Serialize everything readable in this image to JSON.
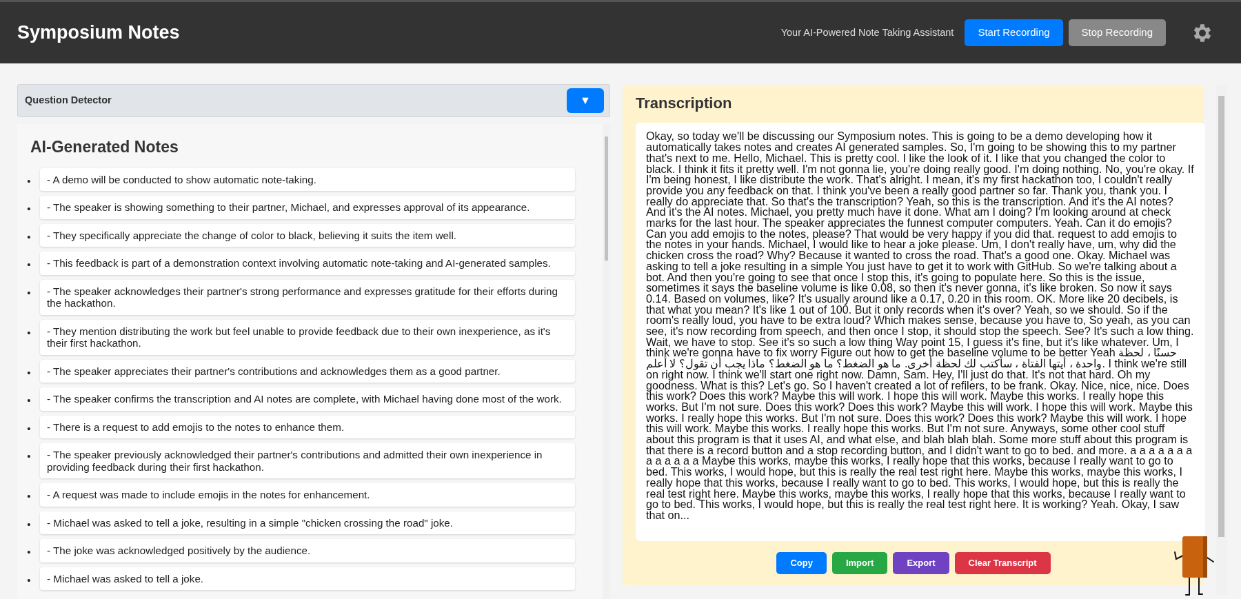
{
  "header": {
    "title": "Symposium Notes",
    "tagline": "Your AI-Powered Note Taking Assistant",
    "start_button": {
      "label": "Start Recording",
      "kind": "primary"
    },
    "stop_button": {
      "label": "Stop Recording",
      "kind": "secondary"
    }
  },
  "question_detector": {
    "title": "Question Detector",
    "toggle": "▼"
  },
  "notes": {
    "title": "AI-Generated Notes",
    "items": [
      {
        "marker": "•",
        "text": "- A demo will be conducted to show automatic note-taking."
      },
      {
        "marker": "•",
        "text": "- The speaker is showing something to their partner, Michael, and expresses approval of its appearance."
      },
      {
        "marker": "•",
        "text": "- They specifically appreciate the change of color to black, believing it suits the item well."
      },
      {
        "marker": "•",
        "text": "- This feedback is part of a demonstration context involving automatic note-taking and AI-generated samples."
      },
      {
        "marker": "•",
        "text": "- The speaker acknowledges their partner's strong performance and expresses gratitude for their efforts during the hackathon."
      },
      {
        "marker": "•",
        "text": "- They mention distributing the work but feel unable to provide feedback due to their own inexperience, as it's their first hackathon."
      },
      {
        "marker": "•",
        "text": "- The speaker appreciates their partner's contributions and acknowledges them as a good partner."
      },
      {
        "marker": "•",
        "text": "- The speaker confirms the transcription and AI notes are complete, with Michael having done most of the work."
      },
      {
        "marker": "•",
        "text": "- There is a request to add emojis to the notes to enhance them."
      },
      {
        "marker": "•",
        "text": "- The speaker previously acknowledged their partner's contributions and admitted their own inexperience in providing feedback during their first hackathon."
      },
      {
        "marker": "•",
        "text": "- A request was made to include emojis in the notes for enhancement."
      },
      {
        "marker": "•",
        "text": "- Michael was asked to tell a joke, resulting in a simple \"chicken crossing the road\" joke."
      },
      {
        "marker": "•",
        "text": "- The joke was acknowledged positively by the audience."
      },
      {
        "marker": "•",
        "text": "- Michael was asked to tell a joke."
      }
    ]
  },
  "transcription": {
    "title": "Transcription",
    "text": "Okay, so today we'll be discussing our Symposium notes. This is going to be a demo developing how it automatically takes notes and creates AI generated samples. So, I'm going to be showing this to my partner that's next to me. Hello, Michael. This is pretty cool. I like the look of it. I like that you changed the color to black. I think it fits it pretty well. I'm not gonna lie, you're doing really good. I'm doing nothing. No, you're okay. If I'm being honest, I like distribute the work. That's alright. I mean, it's my first hackathon too, I couldn't really provide you any feedback on that. I think you've been a really good partner so far. Thank you, thank you. I really do appreciate that. So that's the transcription? Yeah, so this is the transcription. And it's the AI notes? And it's the AI notes. Michael, you pretty much have it done. What am I doing? I'm looking around at check marks for the last hour. The speaker appreciates the funnest computer computers. Yeah. Can it do emojis? Can you add emojis to the notes, please? That would be very happy if you did that. request to add emojis to the notes in your hands. Michael, I would like to hear a joke please. Um, I don't really have, um, why did the chicken cross the road? Why? Because it wanted to cross the road. That's a good one. Okay. Michael was asking to tell a joke resulting in a simple You just have to get it to work with GitHub. So we're talking about a bot. And then you're going to see that once I stop this, it's going to populate here. So this is the issue, sometimes it says the baseline volume is like 0.08, so then it's never gonna, it's like broken. So now it says 0.14. Based on volumes, like? It's usually around like a 0.17, 0.20 in this room. OK. More like 20 decibels, is that what you mean? It's like 1 out of 100. But it only records when it's over? Yeah, so we should. So if the room's really loud, you have to be extra loud? Which makes sense, because you have to, So yeah, as you can see, it's now recording from speech, and then once I stop, it should stop the speech. See? It's such a low thing. Wait, we have to stop. See it's so such a low thing Way point 15, I guess it's fine, but it's like whatever. Um, I think we're gonna have to fix worry Figure out how to get the baseline volume to be better Yeah حسنًا ، لحظة واحدة ، أيتها الفتاة ، سأكتب لك لحظة أخرى. ما هو الضغط؟ ما هو الضغط؟ ماذا يجب أن تقول؟ لا أعلم. I think we're still on right now. I think we'll start one right now. Damn, Sam. Hey, I'll just do that. It's not that hard. Oh my goodness. What is this? Let's go. So I haven't created a lot of refilers, to be frank. Okay. Nice, nice, nice. Does this work? Does this work? Maybe this will work. I hope this will work. Maybe this works. I really hope this works. But I'm not sure. Does this work? Does this work? Maybe this will work. I hope this will work. Maybe this works. I really hope this works. But I'm not sure. Does this work? Does this work? Maybe this will work. I hope this will work. Maybe this works. I really hope this works. But I'm not sure. Anyways, some other cool stuff about this program is that it uses AI, and what else, and blah blah blah. Some more stuff about this program is that there is a record button and a stop recording button, and I didn't want to go to bed. and more. a a a a a a a a a a a a a Maybe this works, maybe this works, I really hope that this works, because I really want to go to bed. This works, I would hope, but this is really the real test right here. Maybe this works, maybe this works, I really hope that this works, because I really want to go to bed. This works, I would hope, but this is really the real test right here. Maybe this works, maybe this works, I really hope that this works, because I really want to go to bed. This works, I would hope, but this is really the real test right here. It is working? Yeah. Okay, I saw that on...",
    "copy_button": {
      "label": "Copy",
      "color": "#007bff"
    },
    "import_button": {
      "label": "Import",
      "color": "#28a745"
    },
    "export_button": {
      "label": "Export",
      "color": "#6f42c1"
    },
    "clear_button": {
      "label": "Clear Transcript",
      "color": "#dc3545"
    }
  }
}
